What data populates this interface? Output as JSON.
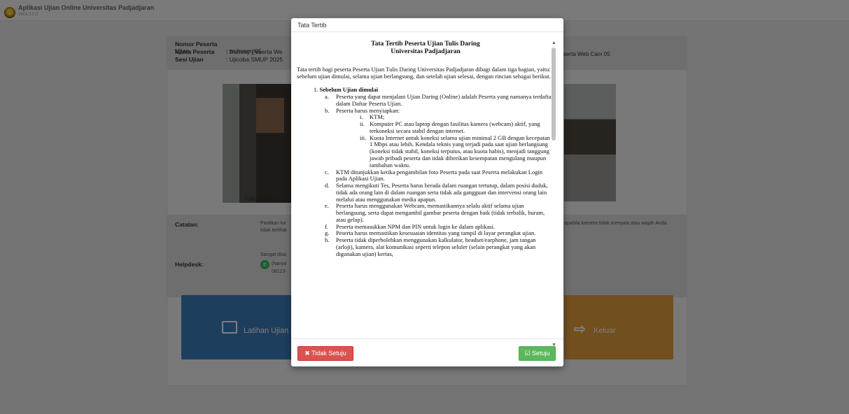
{
  "app": {
    "title": "Aplikasi Ujian Online Universitas Padjadjaran",
    "version": "Versi 3.0.0"
  },
  "participant": {
    "nomor_label": "Nomor Peserta Ujian",
    "nomor_value": ": webcam_05",
    "nama_label": "Nama Peserta",
    "nama_value": ": Dummy Peserta We",
    "sesi_label": "Sesi Ujian",
    "sesi_value": ": Ujicoba SMUP 2025",
    "right_text": "serta Web Cam 05"
  },
  "photo": {
    "label": "Foto Peserta"
  },
  "notes": {
    "catatan_label": "Catatan:",
    "catatan_text_1": "Pastikan ka",
    "catatan_text_2": "tidak terlihat",
    "catatan_right": "apabila kamera tidak menyala atau wajah Anda",
    "helpdesk_label": "Helpdesk:",
    "helpdesk_text_1": "Sangat disa",
    "helpdesk_text_2": "(hanya",
    "helpdesk_text_3": "08123-"
  },
  "buttons": {
    "latihan": "Latihan Ujian",
    "keluar": "Keluar"
  },
  "modal": {
    "header": "Tata Tertib",
    "title_line1": "Tata Tertib Peserta Ujian Tulis Daring",
    "title_line2": "Universitas Padjadjaran",
    "intro": "Tata tertib bagi peserta Peserta Ujian Tulis Daring Universitas Padjadjaran dibagi dalam tiga bagian, yaitu: sebelum ujian dimulai, selama ujian berlangsung, dan setelah ujian selesai, dengan rincian sebagai berikut.",
    "section1_num": "1.",
    "section1_title": "Sebelum Ujian dimulai",
    "items": [
      {
        "mark": "a.",
        "text": "Peserta yang dapat menjalani Ujian Daring (Online) adalah Peserta yang namanya terdaftar dalam Daftar Peserta Ujian."
      },
      {
        "mark": "b.",
        "text": "Peserta harus menyiapkan:"
      },
      {
        "mark": "c.",
        "text": "KTM ditunjukkan ketika pengambilan foto Peserta pada saat Peserta melakukan Login pada Aplikasi Ujian."
      },
      {
        "mark": "d.",
        "text": "Selama mengikuti Tes, Peserta harus berada dalam ruangan tertutup, dalam posisi duduk, tidak ada orang lain di dalam ruangan serta tidak ada gangguan dan intervensi orang lain melalui atau menggunakan media apapun."
      },
      {
        "mark": "e.",
        "text": "Peserta harus menggunakan Webcam, memastikannya selalu aktif selama ujian berlangsung, serta dapat mengambil gambar peserta dengan baik (tidak terbalik, buram, atau gelap)."
      },
      {
        "mark": "f.",
        "text": "Peserta memasukkan NPM dan PIN untuk login ke dalam aplikasi."
      },
      {
        "mark": "g.",
        "text": "Peserta harus memastikan kesesuaian identitas yang tampil di layar perangkat ujian."
      },
      {
        "mark": "h.",
        "text": "Peserta tidak diperbolehkan menggunakan kalkulator, headset/earphone, jam tangan (arloji), kamera, alat komunikasi seperti telepon seluler (selain perangkat yang akan digunakan ujian) kertas,"
      }
    ],
    "subitems": [
      {
        "mark": "i.",
        "text": "KTM;"
      },
      {
        "mark": "ii.",
        "text": "Komputer PC atau laptop dengan fasilitas kamera (webcam) aktif, yang terkoneksi secara stabil dengan internet."
      },
      {
        "mark": "iii.",
        "text": "Kuota Internet untuk koneksi selama ujian minimal 2 GB dengan kecepatan 1 Mbps atau lebih. Kendala teknis yang terjadi pada saat ujian berlangsung (koneksi tidak stabil, koneksi terputus, atau kuota habis), menjadi tanggung jawab pribadi peserta dan tidak diberikan kesempatan mengulang maupun tambahan waktu."
      }
    ],
    "btn_tidak": "✖ Tidak Setuju",
    "btn_setuju": "☑ Setuju"
  }
}
